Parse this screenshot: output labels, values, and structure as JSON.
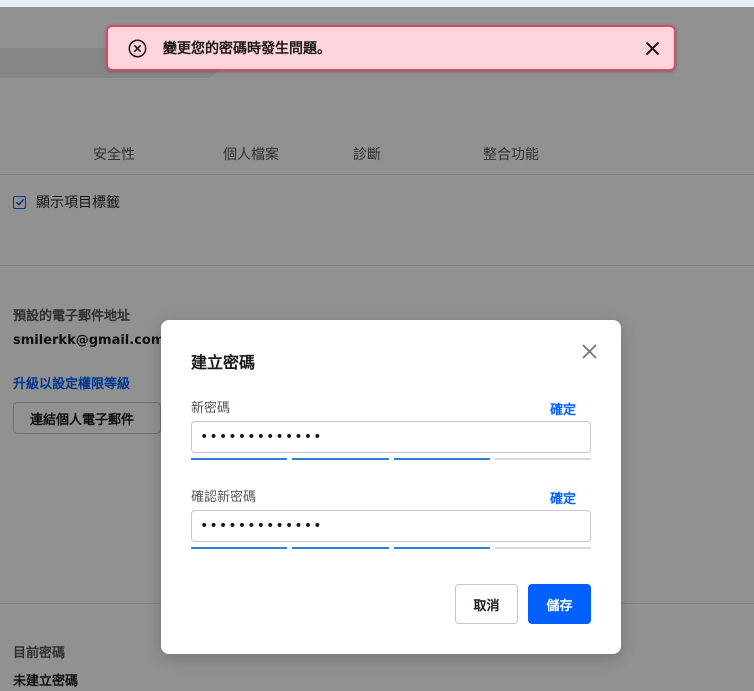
{
  "tabs": [
    "安全性",
    "個人檔案",
    "診斷",
    "整合功能"
  ],
  "settings": {
    "show_labels": "顯示項目標籤",
    "email_heading": "預設的電子郵件地址",
    "email_value": "smilerkk@gmail.com",
    "upgrade_link": "升級以設定權限等級",
    "link_email_button": "連結個人電子郵件",
    "current_password_heading": "目前密碼",
    "current_password_value": "未建立密碼"
  },
  "toast": {
    "message": "變更您的密碼時發生問題。",
    "icons": {
      "status": "error-circle-x-icon",
      "close": "close-icon"
    }
  },
  "modal": {
    "title": "建立密碼",
    "new_password": {
      "label": "新密碼",
      "confirm_link": "確定",
      "value": "•••••••••••••",
      "strength_filled": 3,
      "strength_total": 4
    },
    "confirm_password": {
      "label": "確認新密碼",
      "confirm_link": "確定",
      "value": "•••••••••••••",
      "strength_filled": 3,
      "strength_total": 4
    },
    "cancel_label": "取消",
    "save_label": "儲存"
  },
  "colors": {
    "accent": "#0061fe",
    "toast_bg": "#fbd4dc",
    "toast_border": "#d9476b"
  }
}
